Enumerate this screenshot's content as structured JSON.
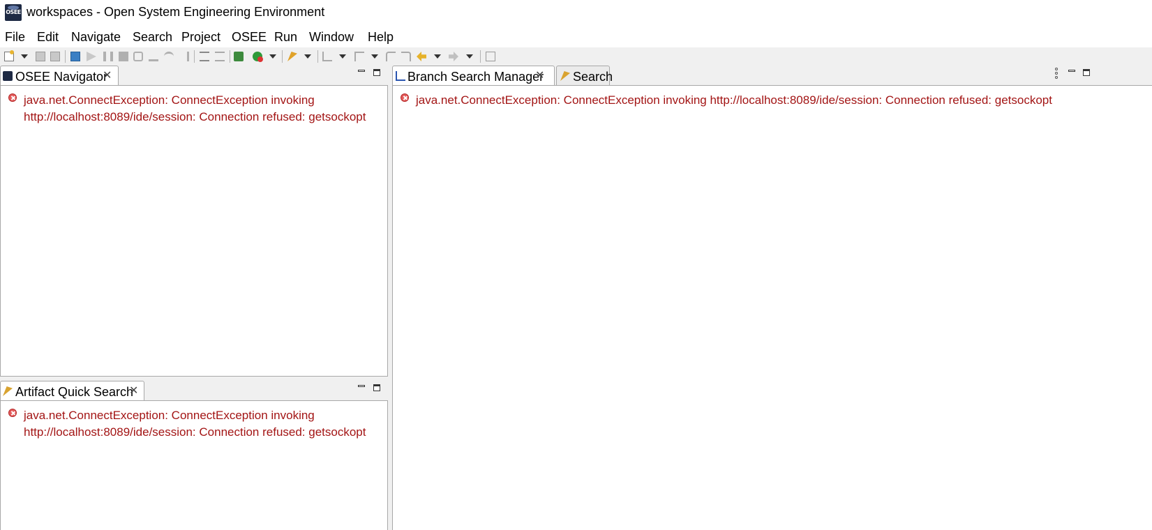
{
  "window": {
    "title": "workspaces - Open System Engineering Environment",
    "app_icon_text": "OSEE"
  },
  "menu": {
    "items": [
      "File",
      "Edit",
      "Navigate",
      "Search",
      "Project",
      "OSEE",
      "Run",
      "Window",
      "Help"
    ]
  },
  "left_top_panel": {
    "tab_label": "OSEE Navigator",
    "close_glyph": "✕",
    "error_line1": "java.net.ConnectException: ConnectException invoking",
    "error_line2": "http://localhost:8089/ide/session: Connection refused: getsockopt"
  },
  "left_bottom_panel": {
    "tab_label": "Artifact Quick Search",
    "close_glyph": "✕",
    "error_line1": "java.net.ConnectException: ConnectException invoking",
    "error_line2": "http://localhost:8089/ide/session: Connection refused: getsockopt"
  },
  "right_panel": {
    "tabs": [
      {
        "label": "Branch Search Manager",
        "close_glyph": "✕"
      },
      {
        "label": "Search"
      }
    ],
    "error_text": "java.net.ConnectException: ConnectException invoking http://localhost:8089/ide/session: Connection refused: getsockopt"
  },
  "colors": {
    "error_text": "#a31515",
    "error_icon": "#e45b5b",
    "panel_border": "#a8a8a8",
    "background": "#f0f0f0"
  }
}
